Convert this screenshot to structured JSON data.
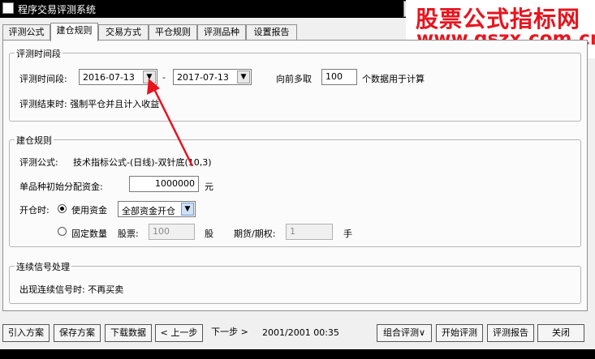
{
  "window": {
    "title": "程序交易评测系统",
    "close_glyph": "×"
  },
  "watermark": {
    "title": "股票公式指标网",
    "url": "www.gszx.com.cn",
    "color": "#e8141e"
  },
  "tabs": [
    {
      "label": "评测公式",
      "active": false
    },
    {
      "label": "建仓规则",
      "active": true
    },
    {
      "label": "交易方式",
      "active": false
    },
    {
      "label": "平仓规则",
      "active": false
    },
    {
      "label": "评测品种",
      "active": false
    },
    {
      "label": "设置报告",
      "active": false
    }
  ],
  "period": {
    "group_title": "评测时间段",
    "label": "评测时间段:",
    "start_date": "2016-07-13",
    "separator": "-",
    "end_date": "2017-07-13",
    "lookback_label": "向前多取",
    "lookback_value": "100",
    "lookback_suffix": "个数据用于计算",
    "end_label": "评测结束时: 强制平仓并且计入收益"
  },
  "position_rules": {
    "group_title": "建仓规则",
    "formula_label": "评测公式:",
    "formula_value": "技术指标公式-(日线)-双针底(10,3)",
    "capital_label": "单品种初始分配资金:",
    "capital_value": "1000000",
    "capital_unit": "元",
    "open_label": "开仓时:",
    "use_capital_label": "使用资金",
    "use_capital_option": "全部资金开仓",
    "fixed_qty_label": "固定数量",
    "stock_label": "股票:",
    "stock_value": "100",
    "stock_unit": "股",
    "futures_label": "期货/期权:",
    "futures_value": "1",
    "futures_unit": "手"
  },
  "continuous_signal": {
    "group_title": "连续信号处理",
    "text": "出现连续信号时: 不再买卖"
  },
  "buttons": {
    "import": "引入方案",
    "save": "保存方案",
    "download": "下载数据",
    "prev": "< 上一步",
    "next": "下一步 >",
    "combo": "组合评测∨",
    "start": "开始评测",
    "report": "评测报告",
    "close": "关闭"
  },
  "status_text": "2001/2001 00:35",
  "annotation_color": "#e8141e"
}
